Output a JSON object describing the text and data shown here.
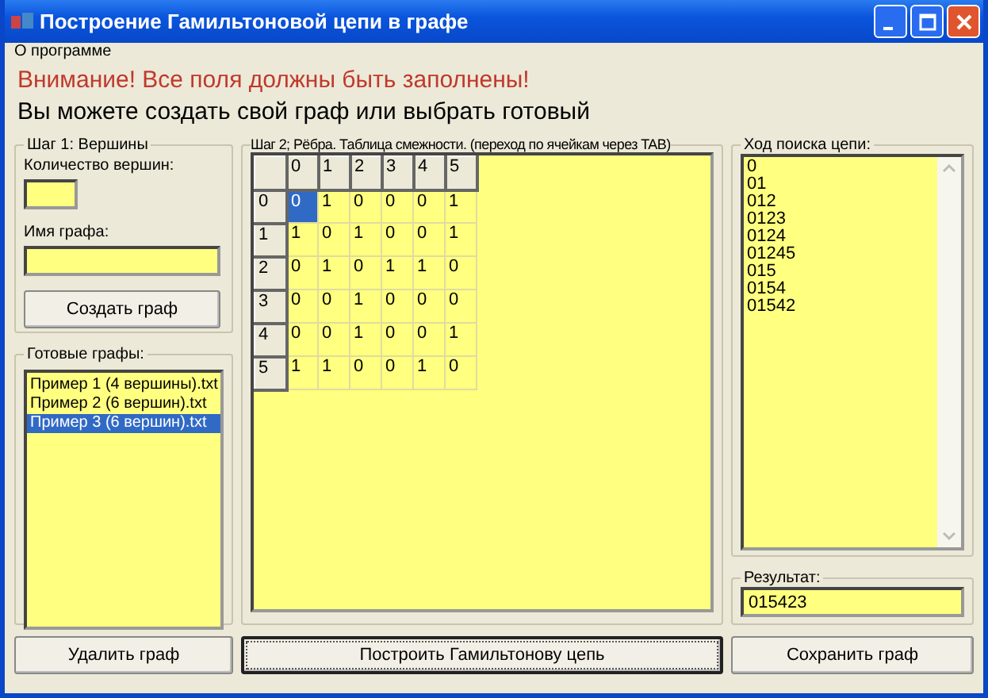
{
  "window": {
    "title": "Построение Гамильтоновой цепи в графе"
  },
  "menu": [
    {
      "label": "О программе"
    }
  ],
  "warning": "Внимание! Все поля должны быть заполнены!",
  "info": "Вы можете создать свой граф или выбрать готовый",
  "step1": {
    "title": "Шаг 1: Вершины",
    "vertices_label": "Количество вершин:",
    "name_label": "Имя графа:",
    "create_button": "Создать граф"
  },
  "ready_graphs": {
    "title": "Готовые графы:",
    "items": [
      {
        "label": "Пример 1 (4 вершины).txt",
        "selected": false
      },
      {
        "label": "Пример 2 (6 вершин).txt",
        "selected": false
      },
      {
        "label": "Пример 3 (6 вершин).txt",
        "selected": true
      }
    ],
    "delete_button": "Удалить граф"
  },
  "step2": {
    "title": "Шаг 2; Рёбра. Таблица смежности. (переход по ячейкам через TAB)",
    "columns": [
      "0",
      "1",
      "2",
      "3",
      "4",
      "5"
    ],
    "rows": [
      {
        "header": "0",
        "cells": [
          {
            "text": "0",
            "selected": true
          },
          {
            "text": "1",
            "selected": false
          },
          {
            "text": "0",
            "selected": false
          },
          {
            "text": "0",
            "selected": false
          },
          {
            "text": "0",
            "selected": false
          },
          {
            "text": "1",
            "selected": false
          }
        ]
      },
      {
        "header": "1",
        "cells": [
          {
            "text": "1",
            "selected": false
          },
          {
            "text": "0",
            "selected": false
          },
          {
            "text": "1",
            "selected": false
          },
          {
            "text": "0",
            "selected": false
          },
          {
            "text": "0",
            "selected": false
          },
          {
            "text": "1",
            "selected": false
          }
        ]
      },
      {
        "header": "2",
        "cells": [
          {
            "text": "0",
            "selected": false
          },
          {
            "text": "1",
            "selected": false
          },
          {
            "text": "0",
            "selected": false
          },
          {
            "text": "1",
            "selected": false
          },
          {
            "text": "1",
            "selected": false
          },
          {
            "text": "0",
            "selected": false
          }
        ]
      },
      {
        "header": "3",
        "cells": [
          {
            "text": "0",
            "selected": false
          },
          {
            "text": "0",
            "selected": false
          },
          {
            "text": "1",
            "selected": false
          },
          {
            "text": "0",
            "selected": false
          },
          {
            "text": "0",
            "selected": false
          },
          {
            "text": "0",
            "selected": false
          }
        ]
      },
      {
        "header": "4",
        "cells": [
          {
            "text": "0",
            "selected": false
          },
          {
            "text": "0",
            "selected": false
          },
          {
            "text": "1",
            "selected": false
          },
          {
            "text": "0",
            "selected": false
          },
          {
            "text": "0",
            "selected": false
          },
          {
            "text": "1",
            "selected": false
          }
        ]
      },
      {
        "header": "5",
        "cells": [
          {
            "text": "1",
            "selected": false
          },
          {
            "text": "1",
            "selected": false
          },
          {
            "text": "0",
            "selected": false
          },
          {
            "text": "0",
            "selected": false
          },
          {
            "text": "1",
            "selected": false
          },
          {
            "text": "0",
            "selected": false
          }
        ]
      }
    ],
    "build_button": "Построить Гамильтонову цепь"
  },
  "search": {
    "title": "Ход поиска цепи:",
    "lines": [
      "0",
      "01",
      "012",
      "0123",
      "0124",
      "01245",
      "015",
      "0154",
      "01542"
    ]
  },
  "result": {
    "title": "Результат:",
    "value": "015423",
    "save_button": "Сохранить граф"
  }
}
